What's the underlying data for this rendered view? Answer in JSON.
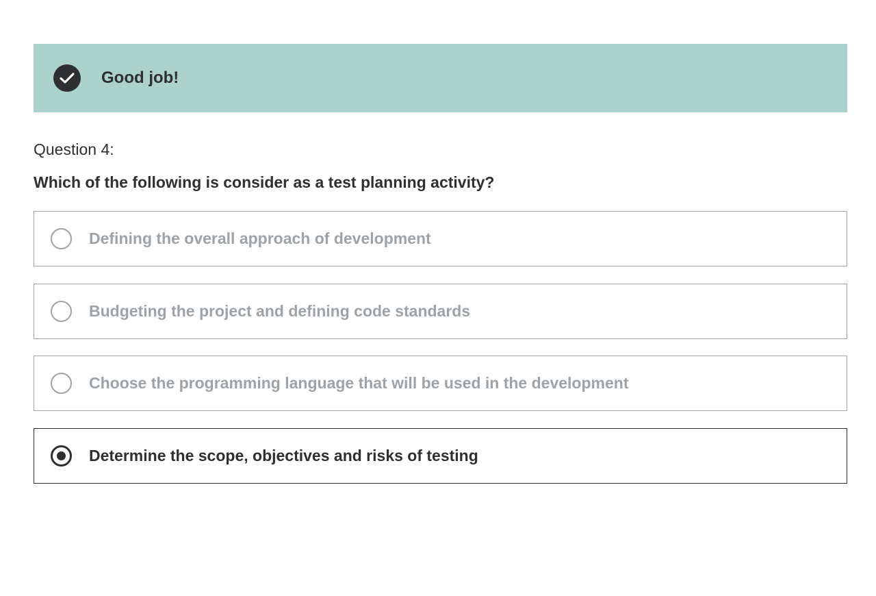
{
  "result": {
    "icon": "check-circle-icon",
    "message": "Good job!",
    "background_color": "#acd2cc"
  },
  "question": {
    "number_label": "Question 4:",
    "prompt": "Which of the following is consider as a test planning activity?"
  },
  "options": [
    {
      "label": "Defining the overall approach of development",
      "selected": false
    },
    {
      "label": "Budgeting the project and defining code standards",
      "selected": false
    },
    {
      "label": "Choose the programming language that will be used in the development",
      "selected": false
    },
    {
      "label": "Determine the scope, objectives and risks of testing",
      "selected": true
    }
  ],
  "colors": {
    "text_primary": "#2d2f31",
    "text_muted": "#9da3a7",
    "success_banner": "#acd2cc"
  }
}
